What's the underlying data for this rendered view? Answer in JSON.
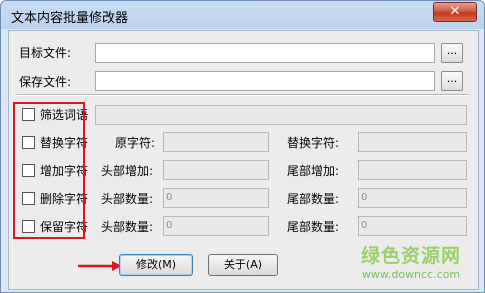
{
  "window": {
    "title": "文本内容批量修改器",
    "close_label": "✕"
  },
  "files": {
    "target_label": "目标文件:",
    "target_value": "",
    "save_label": "保存文件:",
    "save_value": "",
    "browse_label": "..."
  },
  "options": {
    "filter": {
      "label": "筛选词语",
      "value": ""
    },
    "replace": {
      "label": "替换字符",
      "original_label": "原字符:",
      "original_value": "",
      "replacement_label": "替换字符:",
      "replacement_value": ""
    },
    "add": {
      "label": "增加字符",
      "head_label": "头部增加:",
      "head_value": "",
      "tail_label": "尾部增加:",
      "tail_value": ""
    },
    "delete": {
      "label": "删除字符",
      "head_label": "头部数量:",
      "head_value": "0",
      "tail_label": "尾部数量:",
      "tail_value": "0"
    },
    "keep": {
      "label": "保留字符",
      "head_label": "头部数量:",
      "head_value": "0",
      "tail_label": "尾部数量:",
      "tail_value": "0"
    }
  },
  "buttons": {
    "modify": "修改(M)",
    "about": "关于(A)"
  },
  "watermark": {
    "main": "绿色资源网",
    "url": "www.downcc.com"
  },
  "colors": {
    "highlight": "#d9191f",
    "close": "#c0381f"
  }
}
